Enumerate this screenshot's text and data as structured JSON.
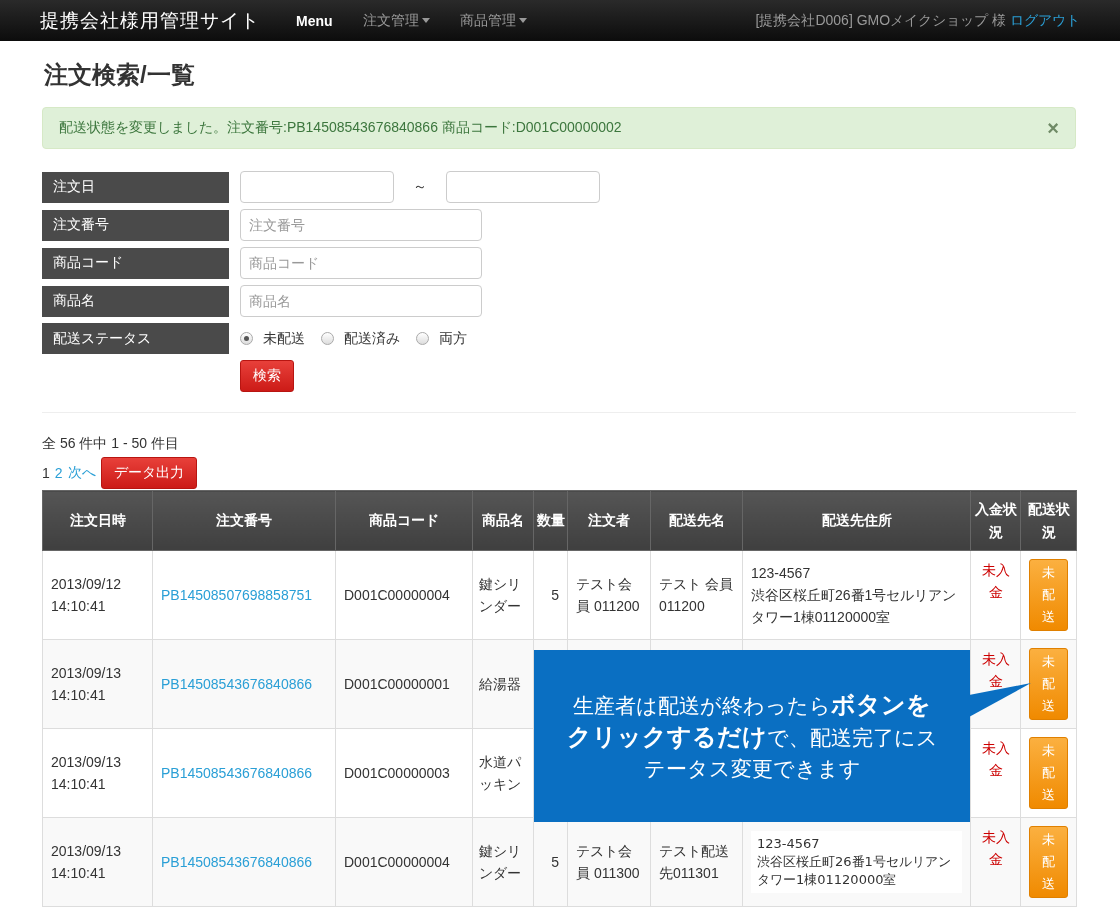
{
  "navbar": {
    "brand": "提携会社様用管理サイト",
    "menu": "Menu",
    "dropdowns": [
      {
        "label": "注文管理"
      },
      {
        "label": "商品管理"
      }
    ],
    "user": "[提携会社D006] GMOメイクショップ 様",
    "logout": "ログアウト"
  },
  "page_title": "注文検索/一覧",
  "alert": {
    "message": "配送状態を変更しました。注文番号:PB14508543676840866 商品コード:D001C00000002",
    "close": "×"
  },
  "search_form": {
    "rows": [
      {
        "kind": "range",
        "label": "注文日",
        "separator": "～"
      },
      {
        "kind": "text",
        "label": "注文番号",
        "placeholder": "注文番号"
      },
      {
        "kind": "text",
        "label": "商品コード",
        "placeholder": "商品コード"
      },
      {
        "kind": "text",
        "label": "商品名",
        "placeholder": "商品名"
      },
      {
        "kind": "radio",
        "label": "配送ステータス",
        "options": [
          {
            "label": "未配送",
            "selected": true
          },
          {
            "label": "配送済み",
            "selected": false
          },
          {
            "label": "両方",
            "selected": false
          }
        ]
      }
    ],
    "submit": "検索"
  },
  "results": {
    "summary": "全 56 件中 1 - 50 件目",
    "pages": [
      {
        "label": "1",
        "selected": true
      },
      {
        "label": "2",
        "selected": false
      }
    ],
    "next": "次へ",
    "export": "データ出力"
  },
  "table": {
    "columns": [
      "注文日時",
      "注文番号",
      "商品コード",
      "商品名",
      "数量",
      "注文者",
      "配送先名",
      "配送先住所",
      "入金状況",
      "配送状況"
    ],
    "rows": [
      {
        "datetime": "2013/09/12 14:10:41",
        "order_no": "PB14508507698858751",
        "product_code": "D001C00000004",
        "product_name": "鍵シリンダー",
        "quantity": "5",
        "orderer": "テスト会員 011200",
        "ship_name": "テスト 会員 011200",
        "address": {
          "kind": "text",
          "postal": "123-4567",
          "street": "渋谷区桜丘町26番1号セルリアンタワー1棟01120000室"
        },
        "payment": "未入金",
        "status_button": "未配送"
      },
      {
        "datetime": "2013/09/13 14:10:41",
        "order_no": "PB14508543676840866",
        "product_code": "D001C00000001",
        "product_name": "給湯器",
        "payment": "未入金",
        "status_button": "未配送"
      },
      {
        "datetime": "2013/09/13 14:10:41",
        "order_no": "PB14508543676840866",
        "product_code": "D001C00000003",
        "product_name": "水道パッキン",
        "payment": "未入金",
        "status_button": "未配送"
      },
      {
        "datetime": "2013/09/13 14:10:41",
        "order_no": "PB14508543676840866",
        "product_code": "D001C00000004",
        "product_name": "鍵シリンダー",
        "quantity": "5",
        "orderer": "テスト会員 011300",
        "ship_name": "テスト配送先011301",
        "address": {
          "kind": "pasted",
          "postal": "123-4567",
          "street": "渋谷区桜丘町26番1号セルリアンタワー1棟01120000室"
        },
        "payment": "未入金",
        "status_button": "未配送"
      }
    ]
  },
  "callout": {
    "text": "生産者は配送が終わったら**ボタンをクリックするだけ**で、配送完了にステータス変更できます"
  }
}
